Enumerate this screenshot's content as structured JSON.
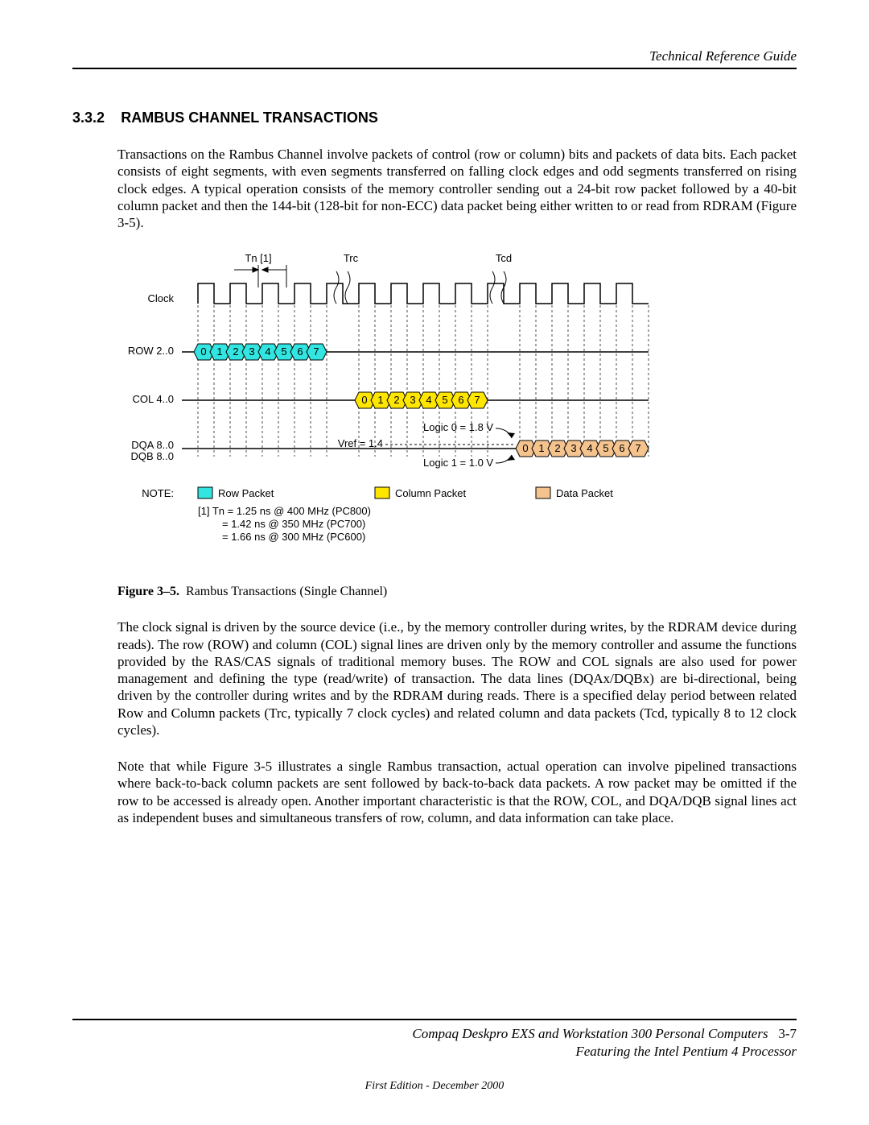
{
  "header": {
    "right": "Technical Reference Guide"
  },
  "section": {
    "num": "3.3.2",
    "title": "RAMBUS CHANNEL TRANSACTIONS"
  },
  "para1": "Transactions on the Rambus Channel involve packets of control (row or column) bits and packets of data bits. Each packet consists of eight segments, with even segments transferred on falling clock edges and odd segments transferred on rising clock edges. A typical operation consists of the memory controller sending out a 24-bit row packet followed by a 40-bit column packet and then the 144-bit (128-bit for non-ECC) data packet being either written to or read from RDRAM (Figure 3-5).",
  "fig": {
    "Tn": "Tn [1]",
    "Trc": "Trc",
    "Tcd": "Tcd",
    "Clock": "Clock",
    "Row": "ROW 2..0",
    "Col": "COL 4..0",
    "DQA": "DQA 8..0",
    "DQB": "DQB 8..0",
    "Vref": "Vref = 1.4",
    "L0": "Logic 0 = 1.8 V",
    "L1": "Logic 1 = 1.0 V",
    "Note": "NOTE:",
    "n1": "[1] Tn = 1.25 ns @ 400 MHz (PC800)",
    "n2": "= 1.42 ns @ 350 MHz (PC700)",
    "n3": "= 1.66 ns @ 300 MHz (PC600)",
    "legRow": "Row Packet",
    "legCol": "Column Packet",
    "legData": "Data Packet",
    "seg": [
      "0",
      "1",
      "2",
      "3",
      "4",
      "5",
      "6",
      "7"
    ]
  },
  "caption": {
    "label": "Figure 3–5.",
    "text": "Rambus Transactions (Single Channel)"
  },
  "para2": "The clock signal is driven by the source device (i.e., by the memory controller during writes, by the RDRAM device during reads). The row (ROW) and column (COL) signal lines are driven only by the memory controller and assume the functions provided by the RAS/CAS signals of traditional memory buses. The ROW and COL signals are also used for power management and defining the type (read/write) of transaction. The data lines (DQAx/DQBx) are bi-directional, being driven by the controller during writes and by the RDRAM during reads. There is a specified delay period between related Row and Column packets (Trc, typically 7 clock cycles) and related column and data packets (Tcd, typically 8 to 12 clock cycles).",
  "para3": "Note that while Figure 3-5 illustrates a single Rambus transaction, actual operation can involve pipelined transactions where back-to-back column packets are sent followed by back-to-back data packets. A row packet may be omitted if the row to be accessed is already open. Another important characteristic is that the ROW, COL, and DQA/DQB signal lines act as independent buses and simultaneous transfers of row, column, and data information can take place.",
  "footer": {
    "line1a": "Compaq Deskpro EXS and Workstation 300 Personal Computers",
    "page": "3-7",
    "line2": "Featuring the Intel Pentium 4 Processor",
    "edition": "First Edition - December  2000"
  }
}
